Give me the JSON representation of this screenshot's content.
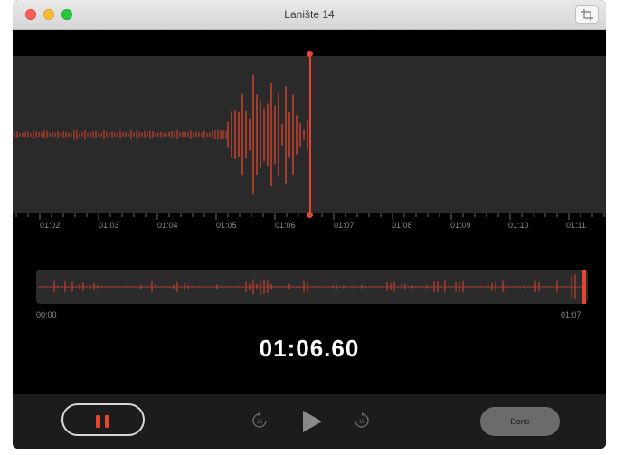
{
  "window": {
    "title": "Lanište 14"
  },
  "ruler": {
    "ticks": [
      "01:02",
      "01:03",
      "01:04",
      "01:05",
      "01:06",
      "01:07",
      "01:08",
      "01:09",
      "01:10",
      "01:11"
    ]
  },
  "overview": {
    "start_time": "00:00",
    "end_time": "01:07"
  },
  "timer": {
    "value": "01:06.60"
  },
  "controls": {
    "skip_back_label": "15",
    "skip_forward_label": "15",
    "done_label": "Done"
  },
  "colors": {
    "accent": "#e5452f",
    "background": "#000000",
    "panel": "#2a2a2a"
  },
  "icons": [
    "crop-icon",
    "pause-icon",
    "skip-back-15-icon",
    "play-icon",
    "skip-forward-15-icon"
  ]
}
